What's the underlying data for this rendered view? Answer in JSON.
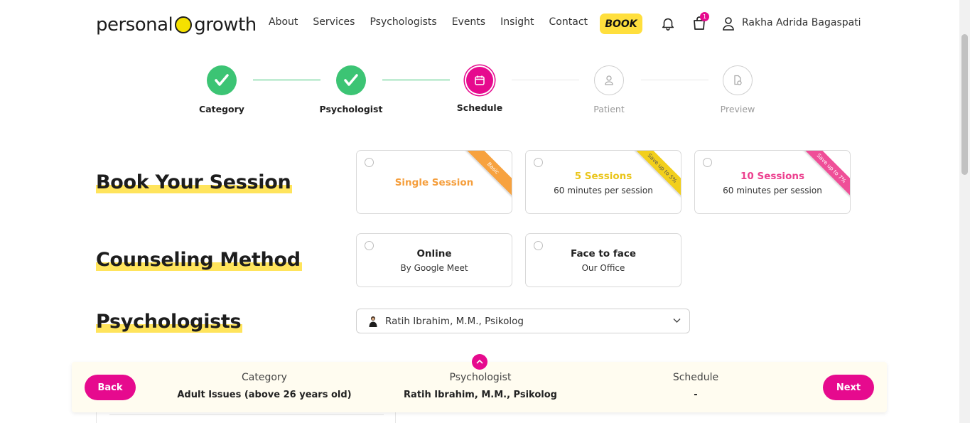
{
  "header": {
    "logo_left": "personal",
    "logo_right": "growth",
    "nav": [
      "About",
      "Services",
      "Psychologists",
      "Events",
      "Insight",
      "Contact"
    ],
    "book_label": "BOOK",
    "cart_count": "1",
    "user_name": "Rakha Adrida Bagaspati"
  },
  "stepper": {
    "steps": [
      {
        "label": "Category",
        "state": "done"
      },
      {
        "label": "Psychologist",
        "state": "done"
      },
      {
        "label": "Schedule",
        "state": "active"
      },
      {
        "label": "Patient",
        "state": "pending"
      },
      {
        "label": "Preview",
        "state": "pending"
      }
    ]
  },
  "sections": {
    "book_session": "Book Your Session",
    "counseling_method": "Counseling Method",
    "psychologists": "Psychologists"
  },
  "session_options": [
    {
      "title": "Single Session",
      "subtitle": "",
      "ribbon": "Basic",
      "title_color": "#f59e3c",
      "ribbon_color": "#f7a23f"
    },
    {
      "title": "5 Sessions",
      "subtitle": "60 minutes per session",
      "ribbon": "Save up to 5%",
      "title_color": "#eac51a",
      "ribbon_color": "#f2cf1b"
    },
    {
      "title": "10 Sessions",
      "subtitle": "60 minutes per session",
      "ribbon": "Save up to 7%",
      "title_color": "#ec3f8e",
      "ribbon_color": "#ef4f98"
    }
  ],
  "method_options": [
    {
      "title": "Online",
      "subtitle": "By Google Meet"
    },
    {
      "title": "Face to face",
      "subtitle": "Our Office"
    }
  ],
  "psychologist_select": {
    "value": "Ratih Ibrahim, M.M., Psikolog"
  },
  "summary": {
    "back_label": "Back",
    "next_label": "Next",
    "category_key": "Category",
    "category_value": "Adult Issues (above 26 years old)",
    "psychologist_key": "Psychologist",
    "psychologist_value": "Ratih Ibrahim, M.M., Psikolog",
    "schedule_key": "Schedule",
    "schedule_value": "-"
  },
  "colors": {
    "accent": "#e60a8e",
    "done": "#3cc474",
    "highlight": "#ffe45c",
    "book": "#ffdf3d"
  }
}
